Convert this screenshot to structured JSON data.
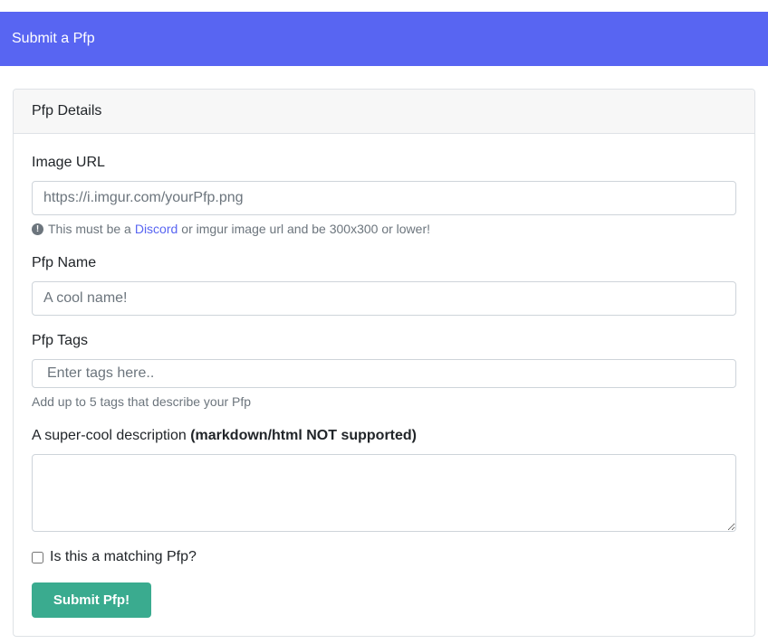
{
  "header": {
    "title": "Submit a Pfp"
  },
  "card": {
    "title": "Pfp Details",
    "image_url": {
      "label": "Image URL",
      "placeholder": "https://i.imgur.com/yourPfp.png",
      "help_prefix": "This must be a",
      "help_link": "Discord",
      "help_suffix": "or imgur image url and be 300x300 or lower!"
    },
    "name": {
      "label": "Pfp Name",
      "placeholder": "A cool name!"
    },
    "tags": {
      "label": "Pfp Tags",
      "placeholder": "Enter tags here..",
      "help": "Add up to 5 tags that describe your Pfp"
    },
    "description": {
      "label": "A super-cool description",
      "label_bold": "(markdown/html NOT supported)",
      "value": ""
    },
    "matching": {
      "label": "Is this a matching Pfp?",
      "checked": false
    },
    "submit_label": "Submit Pfp!"
  },
  "colors": {
    "header_bg": "#5865f2",
    "submit_bg": "#3aab8f",
    "link": "#5865f2"
  },
  "icons": {
    "help": "exclamation-circle-icon"
  }
}
